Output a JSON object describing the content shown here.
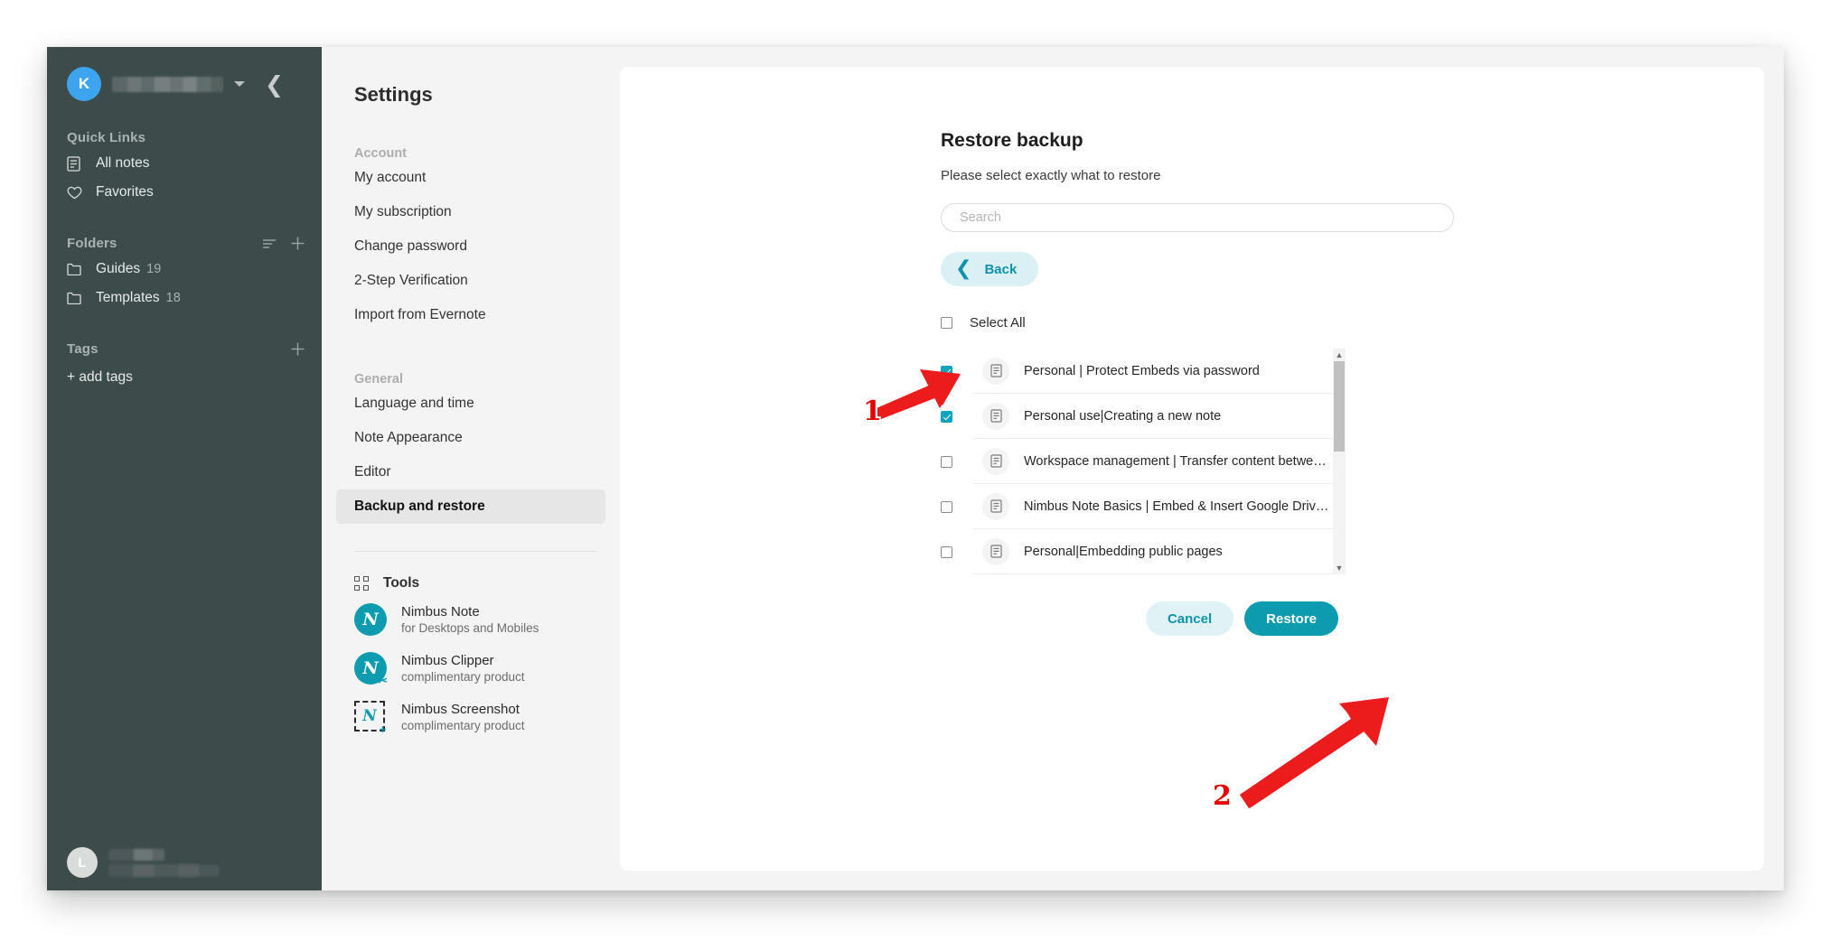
{
  "sidebar": {
    "avatar_initial": "K",
    "username_masked": "",
    "quick_links_label": "Quick Links",
    "quick_links": [
      {
        "label": "All notes",
        "icon": "note-icon"
      },
      {
        "label": "Favorites",
        "icon": "heart-icon"
      }
    ],
    "folders_label": "Folders",
    "folders": [
      {
        "label": "Guides",
        "count": "19",
        "icon": "folder-icon"
      },
      {
        "label": "Templates",
        "count": "18",
        "icon": "folder-icon"
      }
    ],
    "tags_label": "Tags",
    "add_tags_label": "+ add tags",
    "bottom_avatar_initial": "L"
  },
  "settings": {
    "title": "Settings",
    "groups": [
      {
        "label": "Account",
        "items": [
          {
            "label": "My account",
            "active": false
          },
          {
            "label": "My subscription",
            "active": false
          },
          {
            "label": "Change password",
            "active": false
          },
          {
            "label": "2-Step Verification",
            "active": false
          },
          {
            "label": "Import from Evernote",
            "active": false
          }
        ]
      },
      {
        "label": "General",
        "items": [
          {
            "label": "Language and time",
            "active": false
          },
          {
            "label": "Note Appearance",
            "active": false
          },
          {
            "label": "Editor",
            "active": false
          },
          {
            "label": "Backup and restore",
            "active": true
          }
        ]
      }
    ],
    "tools_label": "Tools",
    "tools": [
      {
        "name": "Nimbus Note",
        "sub": "for Desktops and Mobiles",
        "glyph": "N",
        "style": "circle"
      },
      {
        "name": "Nimbus Clipper",
        "sub": "complimentary product",
        "glyph": "N",
        "style": "circle-badge"
      },
      {
        "name": "Nimbus Screenshot",
        "sub": "complimentary product",
        "glyph": "N",
        "style": "dashed"
      }
    ]
  },
  "restore": {
    "title": "Restore backup",
    "subtitle": "Please select exactly what to restore",
    "search_placeholder": "Search",
    "search_value": "",
    "back_label": "Back",
    "select_all_label": "Select All",
    "select_all_checked": false,
    "notes": [
      {
        "title": "Personal | Protect Embeds via password",
        "checked": true
      },
      {
        "title": "Personal use|Creating a new note",
        "checked": true
      },
      {
        "title": "Workspace management | Transfer content between workspa…",
        "checked": false
      },
      {
        "title": "Nimbus Note Basics | Embed & Insert Google Drive files",
        "checked": false
      },
      {
        "title": "Personal|Embedding public pages",
        "checked": false
      }
    ],
    "cancel_label": "Cancel",
    "restore_label": "Restore"
  },
  "annotations": {
    "step1": "1",
    "step2": "2"
  },
  "colors": {
    "accent": "#0d9bb0",
    "accent_light": "#daf0f5",
    "sidebar_bg": "#3d4b4b",
    "avatar_blue": "#3da5f0",
    "annotation_red": "#e60000"
  }
}
